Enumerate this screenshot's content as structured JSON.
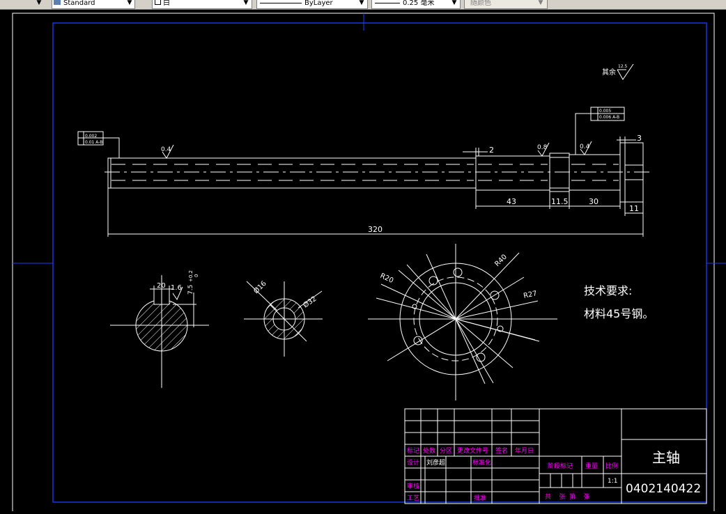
{
  "toolbar": {
    "text_style": "Standard",
    "layer": "白",
    "linetype": "ByLayer",
    "lineweight": "0.25 毫米",
    "plot_style": "随颜色"
  },
  "drawing": {
    "roughness_rest": "其余",
    "roughness_rest_value": "12.5",
    "tol_left_1": "0.002",
    "tol_left_2": "0.01 A-B",
    "tol_right_1": "0.005",
    "tol_right_2": "0.006 A-B",
    "rough_1": "0.4",
    "rough_2": "0.8",
    "rough_3": "0.4",
    "dim_2": "2",
    "dim_3": "3",
    "dim_43": "43",
    "dim_11_5": "11.5",
    "dim_30": "30",
    "dim_11": "11",
    "dim_320": "320",
    "sec_dim_20": "20",
    "sec_rough_16": "1.6",
    "sec_dim_75": "7.5",
    "sec_tol": "+0.2",
    "sec_tol_2": "0",
    "dim_phi16": "Ø16",
    "dim_phi32": "Ø32",
    "dim_r20": "R20",
    "dim_r40": "R40",
    "dim_r27": "R27",
    "tech_title": "技术要求:",
    "tech_material": "材料45号钢。"
  },
  "title_block": {
    "hdr_mark": "标记",
    "hdr_count": "处数",
    "hdr_zone": "分区",
    "hdr_docno": "更改文件号",
    "hdr_sign": "签名",
    "hdr_date": "年月日",
    "design_label": "设计",
    "designer": "刘彦超",
    "standard_label": "标准化",
    "stage_label": "阶段标记",
    "weight_label": "重量",
    "scale_label": "比例",
    "scale_value": "1:1",
    "review_label": "审核",
    "process_label": "工艺",
    "approve_label": "批准",
    "sheets_label": "共    张  第    张",
    "part_name": "主轴",
    "drawing_no": "0402140422"
  }
}
